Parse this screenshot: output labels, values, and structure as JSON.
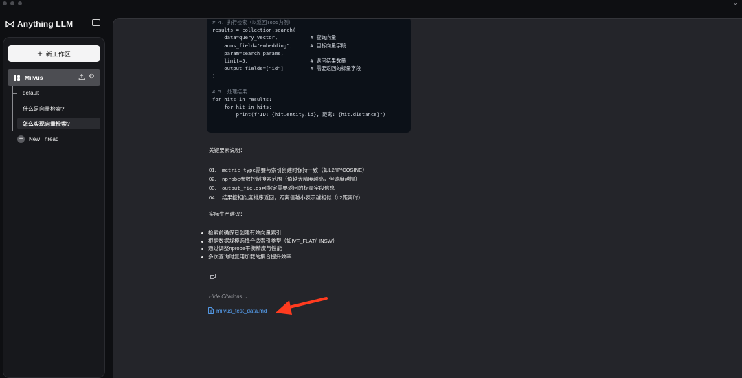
{
  "app": {
    "name": "Anything LLM"
  },
  "sidebar": {
    "new_workspace_label": "新工作区",
    "workspace": {
      "name": "Milvus"
    },
    "threads": [
      {
        "label": "default"
      },
      {
        "label": "什么是向量检索?"
      },
      {
        "label": "怎么实现向量检索?"
      }
    ],
    "new_thread_label": "New Thread"
  },
  "chat": {
    "code_lines": [
      "# 4. 执行检索（以返回Top5为例）",
      "results = collection.search(",
      "    data=query_vector,           # 查询向量",
      "    anns_field=\"embedding\",      # 目标向量字段",
      "    param=search_params,",
      "    limit=5,                     # 返回结果数量",
      "    output_fields=[\"id\"]         # 需要返回的标量字段",
      ")",
      "",
      "# 5. 处理结果",
      "for hits in results:",
      "    for hit in hits:",
      "        print(f\"ID: {hit.entity.id}, 距离: {hit.distance}\")"
    ],
    "key_points_heading": "关键要素说明：",
    "key_points": [
      {
        "num": "01.",
        "code": "metric_type",
        "text": "需要与索引创建时保持一致（如L2/IP/COSINE）"
      },
      {
        "num": "02.",
        "code": "nprobe",
        "text": "参数控制搜索范围（值越大精度越高，但速度越慢）"
      },
      {
        "num": "03.",
        "code": "output_fields",
        "text": "可指定需要返回的标量字段信息"
      },
      {
        "num": "04.",
        "code": "",
        "text": "结果按相似度排序返回，距离值越小表示越相似（L2距离时）"
      }
    ],
    "advice_heading": "实际生产建议：",
    "advice": [
      "检索前确保已创建有效向量索引",
      "根据数据规模选择合适索引类型（如IVF_FLAT/HNSW）",
      "通过调整nprobe平衡精度与性能",
      "多次查询时复用加载的集合提升效率"
    ],
    "hide_citations_label": "Hide Citations",
    "citation_file": "milvus_test_data.md"
  },
  "colors": {
    "accent_link": "#5aa9ff",
    "annotation_arrow": "#ff3b1f"
  }
}
